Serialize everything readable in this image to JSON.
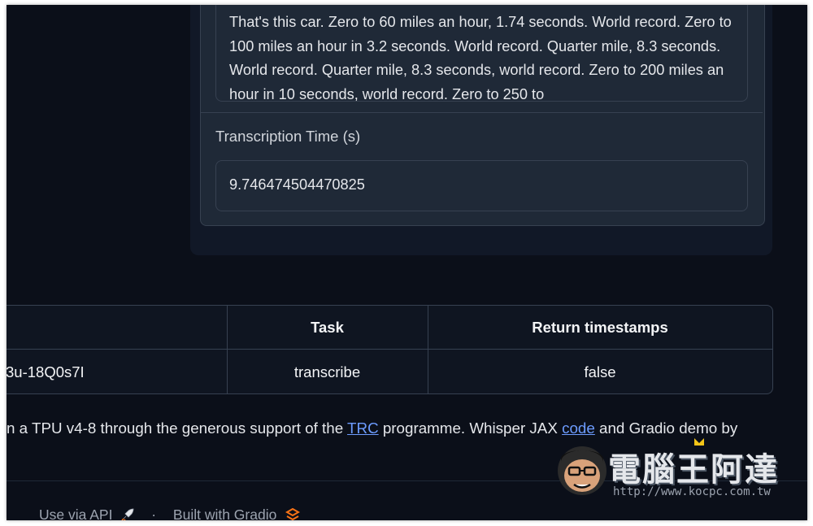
{
  "transcription_text": "That's this car. Zero to 60 miles an hour, 1.74 seconds. World record. Zero to 100 miles an hour in 3.2 seconds. World record. Quarter mile, 8.3 seconds. World record. Quarter mile, 8.3 seconds, world record. Zero to 200 miles an hour in 10 seconds, world record. Zero to 250 to",
  "transcription_time": {
    "label": "Transcription Time (s)",
    "value": "9.746474504470825"
  },
  "examples_table": {
    "headers": [
      "",
      "Task",
      "Return timestamps"
    ],
    "rows": [
      [
        "3u-18Q0s7I",
        "transcribe",
        "false"
      ]
    ]
  },
  "footer_note": {
    "before": "n a TPU v4-8 through the generous support of the ",
    "link1": "TRC",
    "middle": " programme. Whisper JAX ",
    "link2": "code",
    "after": " and Gradio demo by"
  },
  "footer": {
    "api_label": "Use via API",
    "api_icon": "rocket-icon",
    "separator": "·",
    "built_label": "Built with Gradio",
    "built_icon": "gradio-logo-icon"
  },
  "watermark": {
    "title": "電腦王阿達",
    "url": "http://www.kocpc.com.tw"
  },
  "colors": {
    "background": "#0b0f19",
    "panel": "#1f2937",
    "border": "#374151",
    "link": "#6d9cff",
    "gradio_orange": "#f97316"
  }
}
